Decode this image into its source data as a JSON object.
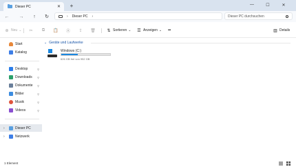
{
  "tab": {
    "title": "Dieser PC",
    "close": "✕"
  },
  "new_tab": "+",
  "window_controls": {
    "minimize": "—",
    "maximize": "☐",
    "close": "✕"
  },
  "nav": {
    "back": "←",
    "forward": "→",
    "up": "↑",
    "refresh": "↻"
  },
  "address": {
    "chevron": "›",
    "breadcrumb": "Dieser PC",
    "chevron_end": "›"
  },
  "search": {
    "placeholder": "Dieser PC durchsuchen"
  },
  "commands": {
    "new_label": "Neu",
    "new_chevron": "⌄",
    "sort_label": "Sortieren",
    "view_label": "Anzeigen",
    "more_label": "•••",
    "details_label": "Details"
  },
  "sidebar": {
    "quick": [
      {
        "label": "Start",
        "color": "#e8883a"
      },
      {
        "label": "Katalog",
        "color": "#3d7ee6"
      }
    ],
    "pinned": [
      {
        "label": "Desktop",
        "color": "#2b7de9",
        "pin": "📌"
      },
      {
        "label": "Downloads",
        "color": "#2aa06a",
        "pin": "📌"
      },
      {
        "label": "Dokumente",
        "color": "#6a7f9a",
        "pin": "📌"
      },
      {
        "label": "Bilder",
        "color": "#3c8ce0",
        "pin": "📌"
      },
      {
        "label": "Musik",
        "color": "#e0533c",
        "pin": "📌"
      },
      {
        "label": "Videos",
        "color": "#8a4fd0",
        "pin": "📌"
      }
    ],
    "locations": [
      {
        "label": "Dieser PC",
        "color": "#5aa0e0",
        "expander": "›"
      },
      {
        "label": "Netzwerk",
        "color": "#3d7ee6",
        "expander": "›"
      }
    ]
  },
  "content": {
    "group_title": "Geräte und Laufwerke",
    "group_chevron": "⌄",
    "drive": {
      "name": "Windows (C:)",
      "free_text": "626 GB frei von 952 GB",
      "used_fraction": 0.342
    }
  },
  "status": {
    "count": "1 Element"
  },
  "colors": {
    "accent": "#1b87e0",
    "titlebar": "#d9e3ef",
    "selection": "#e5e9ee"
  }
}
